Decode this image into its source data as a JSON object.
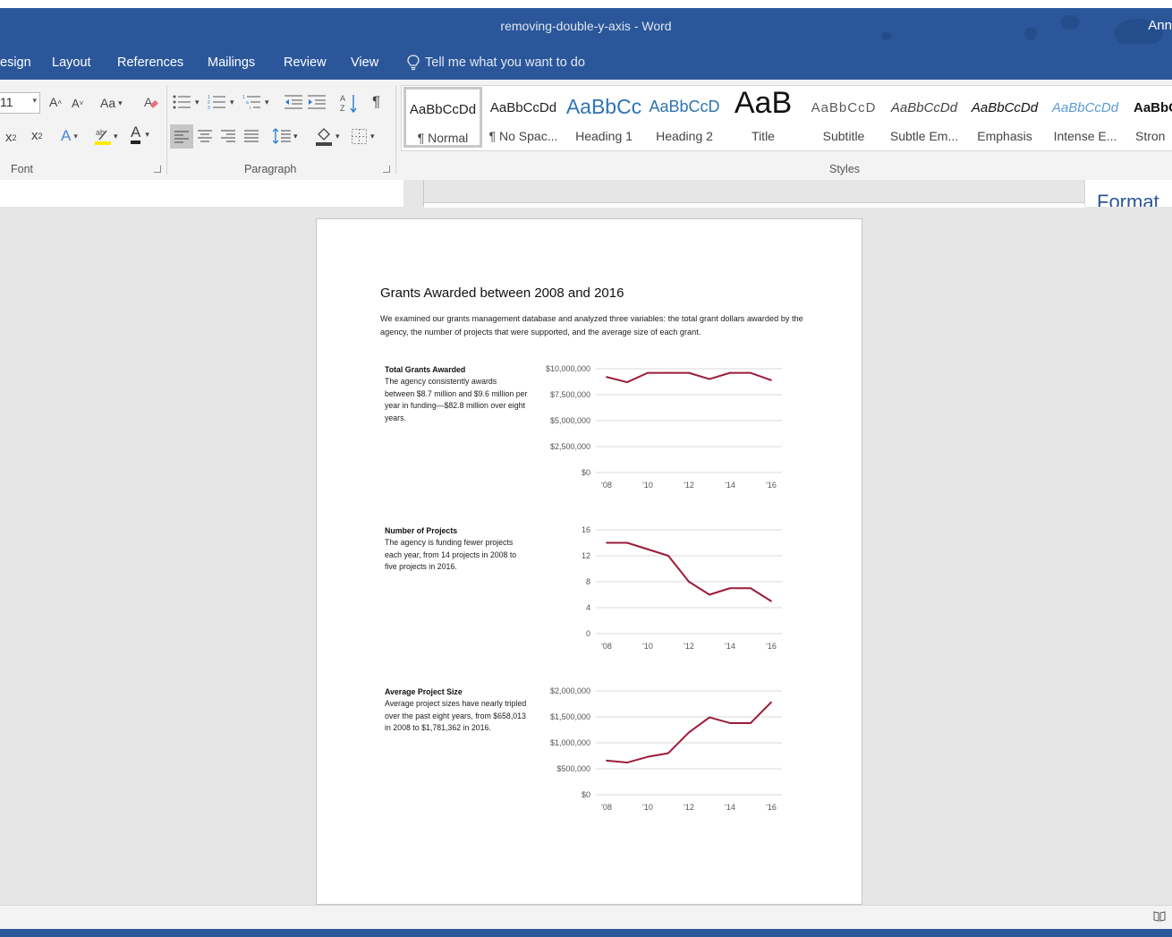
{
  "window": {
    "title": "removing-double-y-axis - Word",
    "user": "Ann"
  },
  "menu": {
    "tabs": [
      "esign",
      "Layout",
      "References",
      "Mailings",
      "Review",
      "View"
    ],
    "tell_me": "Tell me what you want to do"
  },
  "ribbon": {
    "font_size": "11",
    "change_case_label": "Aa",
    "font_color_label": "A",
    "groups": {
      "font": "Font",
      "paragraph": "Paragraph",
      "styles": "Styles"
    },
    "styles": [
      {
        "preview": "AaBbCcDd",
        "label": "¶ Normal"
      },
      {
        "preview": "AaBbCcDd",
        "label": "¶ No Spac..."
      },
      {
        "preview": "AaBbCc",
        "label": "Heading 1"
      },
      {
        "preview": "AaBbCcD",
        "label": "Heading 2"
      },
      {
        "preview": "AaB",
        "label": "Title"
      },
      {
        "preview": "AaBbCcD",
        "label": "Subtitle"
      },
      {
        "preview": "AaBbCcDd",
        "label": "Subtle Em..."
      },
      {
        "preview": "AaBbCcDd",
        "label": "Emphasis"
      },
      {
        "preview": "AaBbCcDd",
        "label": "Intense E..."
      },
      {
        "preview": "AaBbC",
        "label": "Stron"
      }
    ]
  },
  "format_pane": {
    "title": "Format"
  },
  "document": {
    "title": "Grants Awarded between 2008 and 2016",
    "intro": "We examined our grants management database and analyzed three variables: the total grant dollars awarded by the agency, the number of projects that were supported, and the average size of each grant.",
    "sections": [
      {
        "heading": "Total Grants Awarded",
        "text": "The agency consistently awards between $8.7 million and $9.6 million per year in funding—$82.8 million over eight years."
      },
      {
        "heading": "Number of Projects",
        "text": "The agency is funding fewer projects each year, from 14 projects in 2008 to five projects in 2016."
      },
      {
        "heading": "Average Project Size",
        "text": "Average project sizes have nearly tripled over the past eight years, from $658,013 in 2008 to $1,781,362 in 2016."
      }
    ]
  },
  "colors": {
    "accent": "#2b579a",
    "series": "#9b1b3a",
    "grid": "#d9d9d9"
  },
  "chart_data": [
    {
      "type": "line",
      "title": "",
      "x": [
        2008,
        2009,
        2010,
        2011,
        2012,
        2013,
        2014,
        2015,
        2016
      ],
      "tick_labels": [
        "'08",
        "'10",
        "'12",
        "'14",
        "'16"
      ],
      "y_tick_labels": [
        "$10,000,000",
        "$7,500,000",
        "$5,000,000",
        "$2,500,000",
        "$0"
      ],
      "ylim": [
        0,
        10000000
      ],
      "series": [
        {
          "values": [
            9200000,
            8700000,
            9600000,
            9600000,
            9600000,
            9000000,
            9600000,
            9600000,
            8900000
          ]
        }
      ],
      "grid": true
    },
    {
      "type": "line",
      "title": "",
      "x": [
        2008,
        2009,
        2010,
        2011,
        2012,
        2013,
        2014,
        2015,
        2016
      ],
      "tick_labels": [
        "'08",
        "'10",
        "'12",
        "'14",
        "'16"
      ],
      "y_tick_labels": [
        "16",
        "12",
        "8",
        "4",
        "0"
      ],
      "ylim": [
        0,
        16
      ],
      "series": [
        {
          "values": [
            14,
            14,
            13,
            12,
            8,
            6,
            7,
            7,
            5
          ]
        }
      ],
      "grid": true
    },
    {
      "type": "line",
      "title": "",
      "x": [
        2008,
        2009,
        2010,
        2011,
        2012,
        2013,
        2014,
        2015,
        2016
      ],
      "tick_labels": [
        "'08",
        "'10",
        "'12",
        "'14",
        "'16"
      ],
      "y_tick_labels": [
        "$2,000,000",
        "$1,500,000",
        "$1,000,000",
        "$500,000",
        "$0"
      ],
      "ylim": [
        0,
        2000000
      ],
      "series": [
        {
          "values": [
            658013,
            620000,
            730000,
            800000,
            1200000,
            1490000,
            1380000,
            1380000,
            1781362
          ]
        }
      ],
      "grid": true
    }
  ]
}
